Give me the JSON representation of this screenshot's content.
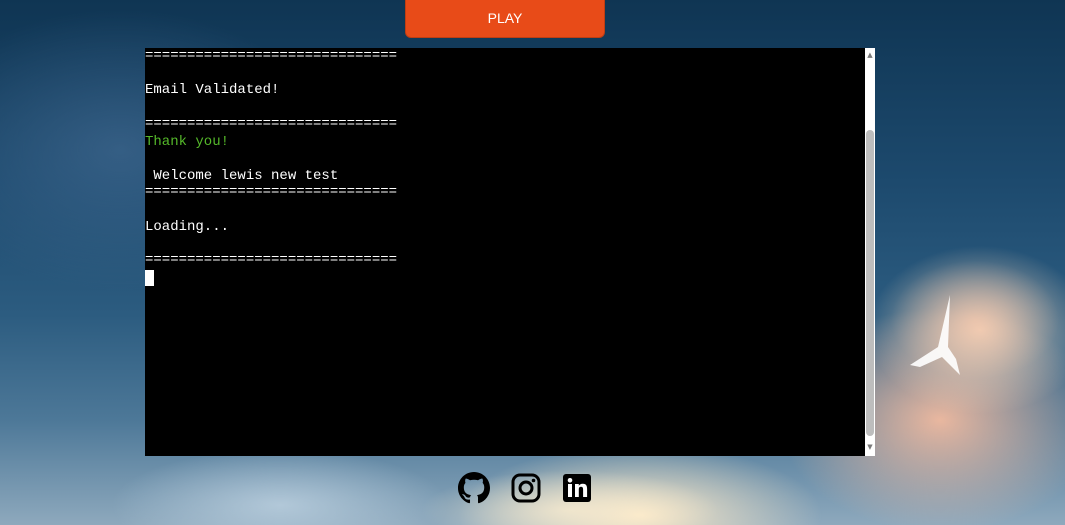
{
  "header": {
    "play_label": "PLAY"
  },
  "terminal": {
    "lines": [
      "==============================",
      "",
      "Email Validated!",
      "",
      "==============================",
      "Thank you!",
      "",
      " Welcome lewis new test",
      "==============================",
      "",
      "Loading...",
      "",
      "=============================="
    ],
    "text_color": "#ffffff",
    "success_color": "#55b92a",
    "background": "#000000"
  },
  "footer": {
    "icons": [
      "github-icon",
      "instagram-icon",
      "linkedin-icon"
    ]
  },
  "colors": {
    "play_button": "#e84b18"
  }
}
